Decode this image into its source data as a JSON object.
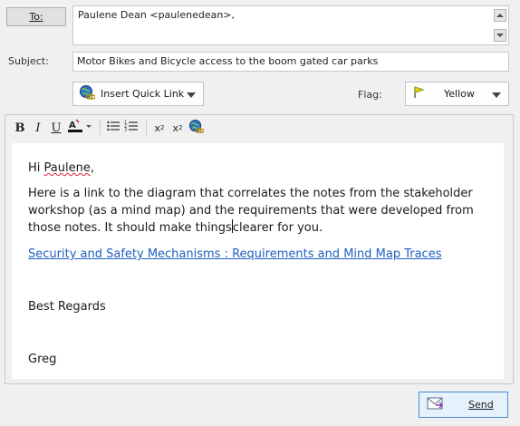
{
  "recipients": {
    "to_button_label": "To:",
    "to_value": "Paulene Dean <paulenedean>,"
  },
  "subject": {
    "label": "Subject:",
    "value": "Motor Bikes and Bicycle access to the boom gated car parks"
  },
  "quick_link": {
    "label": "Insert Quick Link",
    "icon": "globe-link-icon"
  },
  "flag": {
    "label": "Flag:",
    "selected": "Yellow",
    "color": "#e9d800"
  },
  "toolbar": {
    "bold": "B",
    "italic": "I",
    "underline": "U",
    "font_color_icon": "font-color-icon",
    "unordered_list_icon": "bullet-list-icon",
    "ordered_list_icon": "numbered-list-icon",
    "superscript": "x",
    "superscript_mark": "2",
    "subscript": "x",
    "subscript_mark": "2",
    "link_icon": "globe-link-icon"
  },
  "message": {
    "greeting_prefix": "Hi ",
    "greeting_name": "Paulene",
    "greeting_suffix": ",",
    "paragraph_before_caret": "Here is a link to the diagram that correlates the notes from the stakeholder workshop (as a mind map) and the requirements that were developed from those notes.  It should make things",
    "paragraph_after_caret": "clearer for you.",
    "link_text": "Security and Safety Mechanisms : Requirements and Mind Map Traces",
    "regards": "Best Regards",
    "signature": "Greg"
  },
  "send": {
    "label": "Send",
    "icon": "send-envelope-icon"
  }
}
